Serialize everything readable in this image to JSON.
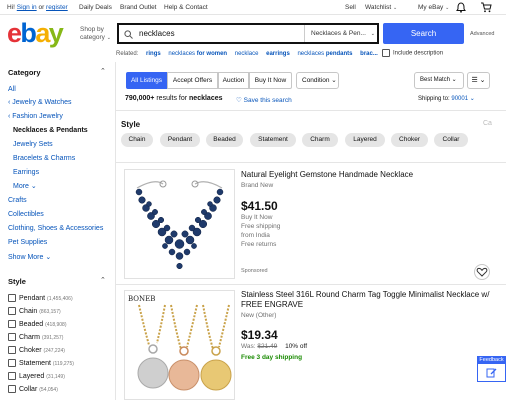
{
  "topnav": {
    "greeting": "Hi!",
    "sign_in": "Sign in",
    "or": "or",
    "register": "register",
    "daily_deals": "Daily Deals",
    "brand_outlet": "Brand Outlet",
    "help_contact": "Help & Contact",
    "sell": "Sell",
    "watchlist": "Watchlist",
    "my_ebay": "My eBay",
    "bell_icon": "bell-icon",
    "cart_icon": "cart-icon"
  },
  "header": {
    "logo": {
      "e": "e",
      "b": "b",
      "a": "a",
      "y": "y"
    },
    "shop_by_line1": "Shop by",
    "shop_by_line2": "category",
    "search_value": "necklaces",
    "category_select": "Necklaces & Pen...",
    "search_button": "Search",
    "advanced": "Advanced"
  },
  "related": {
    "label": "Related:",
    "items": [
      {
        "pre": "",
        "bold": "rings",
        "post": ""
      },
      {
        "pre": "necklaces ",
        "bold": "for women",
        "post": ""
      },
      {
        "pre": "necklace",
        "bold": "",
        "post": ""
      },
      {
        "pre": "",
        "bold": "earrings",
        "post": ""
      },
      {
        "pre": "necklaces ",
        "bold": "pendants",
        "post": ""
      },
      {
        "pre": "",
        "bold": "brac...",
        "post": ""
      }
    ],
    "include_description": "Include description"
  },
  "sidebar": {
    "category_heading": "Category",
    "all": "All",
    "jewelry_watches": "‹ Jewelry & Watches",
    "fashion_jewelry": "‹ Fashion Jewelry",
    "current": "Necklaces & Pendants",
    "subcats": [
      "Jewelry Sets",
      "Bracelets & Charms",
      "Earrings",
      "More ⌄"
    ],
    "other_cats": [
      "Crafts",
      "Collectibles",
      "Clothing, Shoes & Accessories",
      "Pet Supplies",
      "Show More ⌄"
    ],
    "style_heading": "Style",
    "styles": [
      {
        "name": "Pendant",
        "count": "(1,455,406)"
      },
      {
        "name": "Chain",
        "count": "(863,157)"
      },
      {
        "name": "Beaded",
        "count": "(418,908)"
      },
      {
        "name": "Charm",
        "count": "(391,257)"
      },
      {
        "name": "Choker",
        "count": "(247,224)"
      },
      {
        "name": "Statement",
        "count": "(119,275)"
      },
      {
        "name": "Layered",
        "count": "(31,149)"
      },
      {
        "name": "Collar",
        "count": "(54,054)"
      }
    ]
  },
  "toolbar": {
    "tabs": [
      "All Listings",
      "Accept Offers",
      "Auction",
      "Buy It Now"
    ],
    "condition": "Condition ⌄",
    "sort": "Best Match ⌄",
    "view": "☰ ⌄"
  },
  "results": {
    "count": "790,000+",
    "text": " results for ",
    "query": "necklaces",
    "save_search": "Save this search",
    "ship_to_label": "Shipping to: ",
    "ship_to_zip": "90001 ⌄"
  },
  "style_filter": {
    "title": "Style",
    "chips": [
      "Chain",
      "Pendant",
      "Beaded",
      "Statement",
      "Charm",
      "Layered",
      "Choker",
      "Collar"
    ],
    "overflow": "Ca"
  },
  "items": [
    {
      "title": "Natural Eyelight Gemstone Handmade Necklace",
      "condition": "Brand New",
      "price": "$41.50",
      "buy_format": "Buy It Now",
      "shipping": "Free shipping",
      "location": "from India",
      "returns": "Free returns",
      "sponsored": "Sponsored"
    },
    {
      "title": "Stainless Steel 316L Round Charm Tag Toggle Minimalist Necklace w/ FREE ENGRAVE",
      "condition": "New (Other)",
      "price": "$19.34",
      "was_label": "Was: ",
      "was_price": "$21.49",
      "discount": "10% off",
      "shipping_fast": "Free 3 day shipping",
      "brand_mark": "BONEB"
    }
  ],
  "feedback": {
    "label": "Feedback"
  },
  "colors": {
    "accent": "#3665f3",
    "link": "#0654ba",
    "logo_e": "#e53238",
    "logo_b": "#0064d2",
    "logo_a": "#f5af02",
    "logo_y": "#86b817",
    "free_shipping": "#188a00"
  }
}
